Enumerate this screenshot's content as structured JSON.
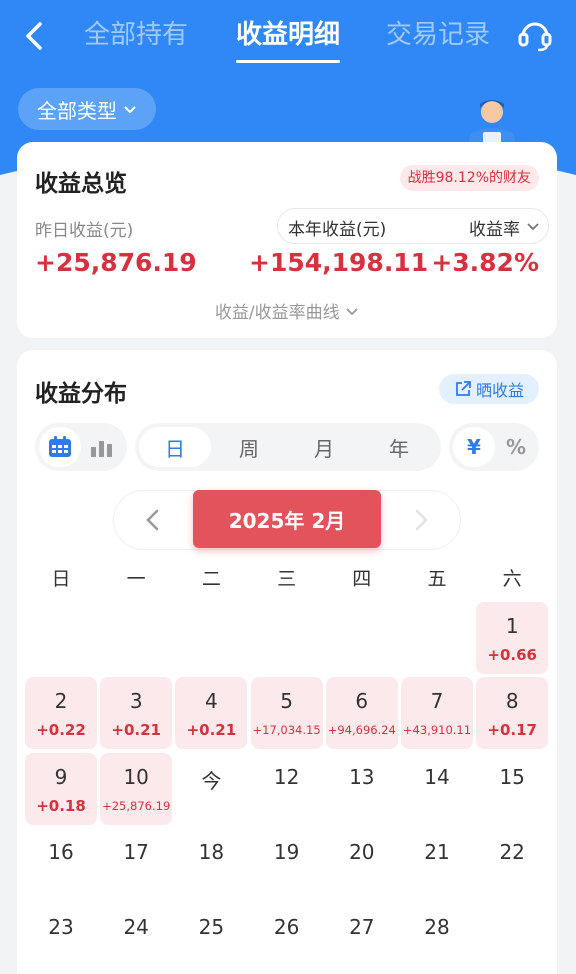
{
  "tabs": [
    {
      "label": "全部持有",
      "active": false
    },
    {
      "label": "收益明细",
      "active": true
    },
    {
      "label": "交易记录",
      "active": false
    }
  ],
  "filter": {
    "label": "全部类型"
  },
  "overview": {
    "title": "收益总览",
    "rank_badge": "战胜98.12%的财友",
    "yesterday_label": "昨日收益(元)",
    "year_label": "本年收益(元)",
    "rate_label": "收益率",
    "yesterday_value": "+25,876.19",
    "year_value": "+154,198.11",
    "rate_value": "+3.82%",
    "curve_link": "收益/收益率曲线"
  },
  "distribution": {
    "title": "收益分布",
    "share_label": "晒收益",
    "period_options": [
      "日",
      "周",
      "月",
      "年"
    ],
    "period_selected": "日",
    "unit_options": [
      "¥",
      "%"
    ],
    "unit_selected": "¥",
    "month_label": "2025年 2月",
    "weekdays": [
      "日",
      "一",
      "二",
      "三",
      "四",
      "五",
      "六"
    ],
    "days": [
      {
        "day": "1",
        "value": "+0.66"
      },
      {
        "day": "2",
        "value": "+0.22"
      },
      {
        "day": "3",
        "value": "+0.21"
      },
      {
        "day": "4",
        "value": "+0.21"
      },
      {
        "day": "5",
        "value": "+17,034.15"
      },
      {
        "day": "6",
        "value": "+94,696.24"
      },
      {
        "day": "7",
        "value": "+43,910.11"
      },
      {
        "day": "8",
        "value": "+0.17"
      },
      {
        "day": "9",
        "value": "+0.18"
      },
      {
        "day": "10",
        "value": "+25,876.19"
      },
      {
        "day": "今",
        "value": ""
      },
      {
        "day": "12",
        "value": ""
      },
      {
        "day": "13",
        "value": ""
      },
      {
        "day": "14",
        "value": ""
      },
      {
        "day": "15",
        "value": ""
      },
      {
        "day": "16",
        "value": ""
      },
      {
        "day": "17",
        "value": ""
      },
      {
        "day": "18",
        "value": ""
      },
      {
        "day": "19",
        "value": ""
      },
      {
        "day": "20",
        "value": ""
      },
      {
        "day": "21",
        "value": ""
      },
      {
        "day": "22",
        "value": ""
      },
      {
        "day": "23",
        "value": ""
      },
      {
        "day": "24",
        "value": ""
      },
      {
        "day": "25",
        "value": ""
      },
      {
        "day": "26",
        "value": ""
      },
      {
        "day": "27",
        "value": ""
      },
      {
        "day": "28",
        "value": ""
      }
    ]
  },
  "colors": {
    "brand_blue": "#2f88f5",
    "gain_red": "#d9303e",
    "month_red": "#e2535c",
    "cell_pink": "#fce9eb"
  },
  "icons": {
    "back": "chevron-left-icon",
    "service": "headset-icon",
    "share": "share-out-icon",
    "calendar": "calendar-icon",
    "bars": "bar-chart-icon"
  }
}
